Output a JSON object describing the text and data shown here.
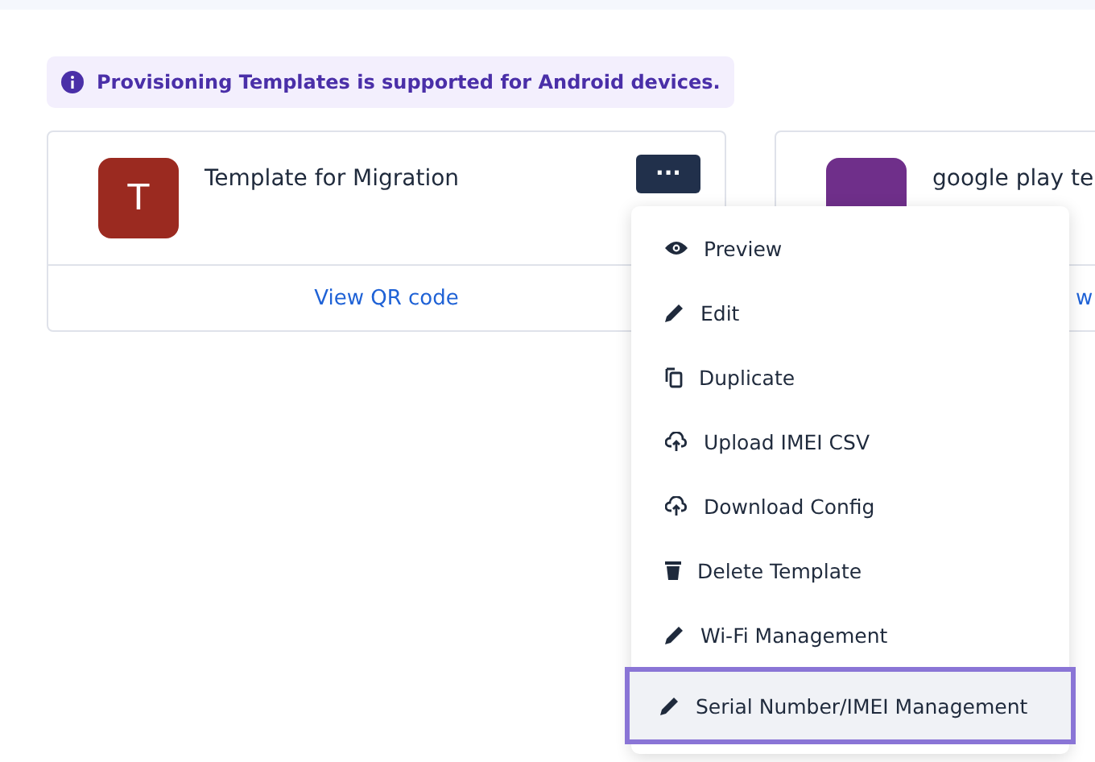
{
  "banner": {
    "text": "Provisioning Templates is supported for Android devices."
  },
  "cards": [
    {
      "initial": "T",
      "color": "#9b2a20",
      "title": "Template for Migration",
      "link": "View QR code",
      "menu_button": "···"
    },
    {
      "color": "#6f2f8a",
      "title": "google play te",
      "link": "w"
    }
  ],
  "menu": {
    "items": [
      {
        "kind": "eye",
        "label": "Preview",
        "selected": false
      },
      {
        "kind": "pencil",
        "label": "Edit",
        "selected": false
      },
      {
        "kind": "copy",
        "label": "Duplicate",
        "selected": false
      },
      {
        "kind": "upload",
        "label": "Upload IMEI CSV",
        "selected": false
      },
      {
        "kind": "cloud",
        "label": "Download Config",
        "selected": false
      },
      {
        "kind": "trash",
        "label": "Delete Template",
        "selected": false
      },
      {
        "kind": "pencil",
        "label": "Wi-Fi Management",
        "selected": false
      },
      {
        "kind": "pencil",
        "label": "Serial Number/IMEI Management",
        "selected": true
      }
    ]
  }
}
